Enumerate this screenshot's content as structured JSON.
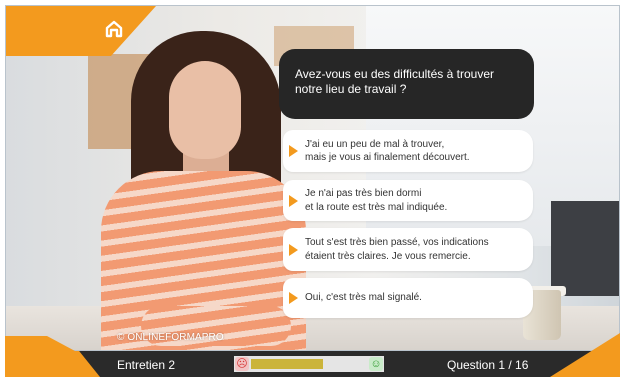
{
  "question": {
    "text": "Avez-vous eu des difficultés à trouver notre lieu de travail ?"
  },
  "answers": [
    {
      "text": "J'ai eu un peu de mal à trouver,\nmais je vous ai finalement découvert."
    },
    {
      "text": "Je n'ai pas très bien dormi\net la route est très mal indiquée."
    },
    {
      "text": "Tout s'est très bien passé, vos indications\nétaient très claires. Je vous remercie."
    },
    {
      "text": "Oui, c'est très mal signalé."
    }
  ],
  "watermark": "© ONLINEFORMAPRO",
  "footer": {
    "title": "Entretien 2",
    "question_count": "Question 1 / 16",
    "progress_fraction": 0.62
  },
  "icons": {
    "home": "home-icon",
    "sad": "sad-face-icon",
    "happy": "happy-face-icon",
    "answer_marker": "arrow-right-icon"
  },
  "colors": {
    "accent": "#f39a1e",
    "bubble": "#262626",
    "footer": "#2a2a2a",
    "progress": "#cbb43a"
  }
}
